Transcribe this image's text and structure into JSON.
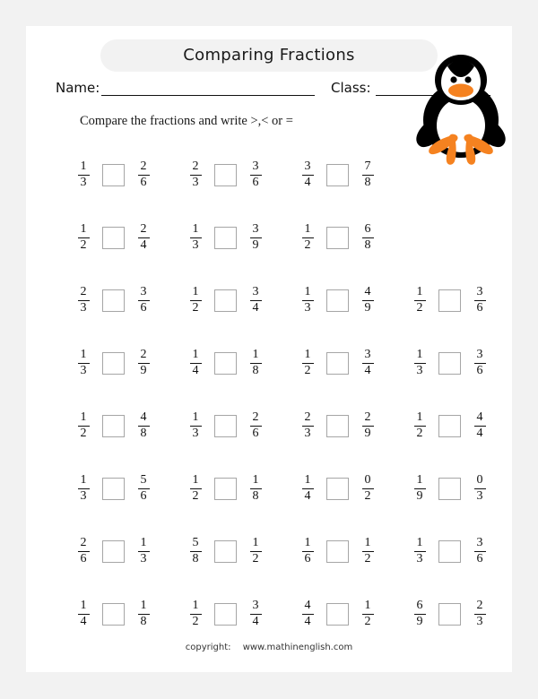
{
  "header": {
    "title": "Comparing Fractions",
    "name_label": "Name:",
    "class_label": "Class:",
    "instruction": "Compare the fractions and write >,< or ="
  },
  "colors": {
    "page_background": "#ffffff",
    "outer_background": "#f2f2f2",
    "title_pill": "#f2f2f2",
    "answer_box_border": "#a6a6a6",
    "penguin_body": "#000000",
    "penguin_belly": "#ffffff",
    "penguin_beak": "#f58220",
    "text": "#111111"
  },
  "illustration": {
    "name": "penguin-illustration",
    "description": "penguin"
  },
  "rows": [
    {
      "cells": [
        {
          "left": {
            "num": "1",
            "den": "3"
          },
          "answer": "",
          "right": {
            "num": "2",
            "den": "6"
          }
        },
        {
          "left": {
            "num": "2",
            "den": "3"
          },
          "answer": "",
          "right": {
            "num": "3",
            "den": "6"
          }
        },
        {
          "left": {
            "num": "3",
            "den": "4"
          },
          "answer": "",
          "right": {
            "num": "7",
            "den": "8"
          }
        }
      ]
    },
    {
      "cells": [
        {
          "left": {
            "num": "1",
            "den": "2"
          },
          "answer": "",
          "right": {
            "num": "2",
            "den": "4"
          }
        },
        {
          "left": {
            "num": "1",
            "den": "3"
          },
          "answer": "",
          "right": {
            "num": "3",
            "den": "9"
          }
        },
        {
          "left": {
            "num": "1",
            "den": "2"
          },
          "answer": "",
          "right": {
            "num": "6",
            "den": "8"
          }
        }
      ]
    },
    {
      "cells": [
        {
          "left": {
            "num": "2",
            "den": "3"
          },
          "answer": "",
          "right": {
            "num": "3",
            "den": "6"
          }
        },
        {
          "left": {
            "num": "1",
            "den": "2"
          },
          "answer": "",
          "right": {
            "num": "3",
            "den": "4"
          }
        },
        {
          "left": {
            "num": "1",
            "den": "3"
          },
          "answer": "",
          "right": {
            "num": "4",
            "den": "9"
          }
        },
        {
          "left": {
            "num": "1",
            "den": "2"
          },
          "answer": "",
          "right": {
            "num": "3",
            "den": "6"
          }
        }
      ]
    },
    {
      "cells": [
        {
          "left": {
            "num": "1",
            "den": "3"
          },
          "answer": "",
          "right": {
            "num": "2",
            "den": "9"
          }
        },
        {
          "left": {
            "num": "1",
            "den": "4"
          },
          "answer": "",
          "right": {
            "num": "1",
            "den": "8"
          }
        },
        {
          "left": {
            "num": "1",
            "den": "2"
          },
          "answer": "",
          "right": {
            "num": "3",
            "den": "4"
          }
        },
        {
          "left": {
            "num": "1",
            "den": "3"
          },
          "answer": "",
          "right": {
            "num": "3",
            "den": "6"
          }
        }
      ]
    },
    {
      "cells": [
        {
          "left": {
            "num": "1",
            "den": "2"
          },
          "answer": "",
          "right": {
            "num": "4",
            "den": "8"
          }
        },
        {
          "left": {
            "num": "1",
            "den": "3"
          },
          "answer": "",
          "right": {
            "num": "2",
            "den": "6"
          }
        },
        {
          "left": {
            "num": "2",
            "den": "3"
          },
          "answer": "",
          "right": {
            "num": "2",
            "den": "9"
          }
        },
        {
          "left": {
            "num": "1",
            "den": "2"
          },
          "answer": "",
          "right": {
            "num": "4",
            "den": "4"
          }
        }
      ]
    },
    {
      "cells": [
        {
          "left": {
            "num": "1",
            "den": "3"
          },
          "answer": "",
          "right": {
            "num": "5",
            "den": "6"
          }
        },
        {
          "left": {
            "num": "1",
            "den": "2"
          },
          "answer": "",
          "right": {
            "num": "1",
            "den": "8"
          }
        },
        {
          "left": {
            "num": "1",
            "den": "4"
          },
          "answer": "",
          "right": {
            "num": "0",
            "den": "2"
          }
        },
        {
          "left": {
            "num": "1",
            "den": "9"
          },
          "answer": "",
          "right": {
            "num": "0",
            "den": "3"
          }
        }
      ]
    },
    {
      "cells": [
        {
          "left": {
            "num": "2",
            "den": "6"
          },
          "answer": "",
          "right": {
            "num": "1",
            "den": "3"
          }
        },
        {
          "left": {
            "num": "5",
            "den": "8"
          },
          "answer": "",
          "right": {
            "num": "1",
            "den": "2"
          }
        },
        {
          "left": {
            "num": "1",
            "den": "6"
          },
          "answer": "",
          "right": {
            "num": "1",
            "den": "2"
          }
        },
        {
          "left": {
            "num": "1",
            "den": "3"
          },
          "answer": "",
          "right": {
            "num": "3",
            "den": "6"
          }
        }
      ]
    },
    {
      "cells": [
        {
          "left": {
            "num": "1",
            "den": "4"
          },
          "answer": "",
          "right": {
            "num": "1",
            "den": "8"
          }
        },
        {
          "left": {
            "num": "1",
            "den": "2"
          },
          "answer": "",
          "right": {
            "num": "3",
            "den": "4"
          }
        },
        {
          "left": {
            "num": "4",
            "den": "4"
          },
          "answer": "",
          "right": {
            "num": "1",
            "den": "2"
          }
        },
        {
          "left": {
            "num": "6",
            "den": "9"
          },
          "answer": "",
          "right": {
            "num": "2",
            "den": "3"
          }
        }
      ]
    }
  ],
  "footer": {
    "copyright_label": "copyright:",
    "website": "www.mathinenglish.com"
  }
}
